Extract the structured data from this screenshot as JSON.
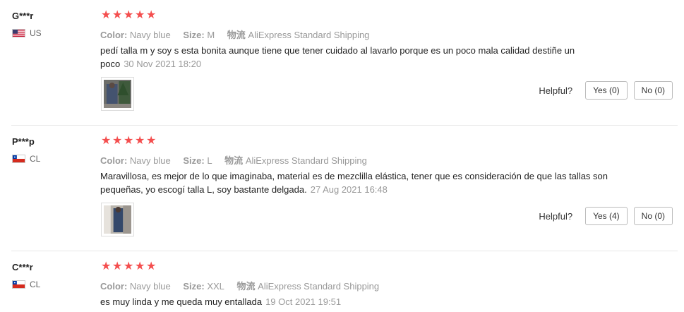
{
  "reviews": [
    {
      "user": "G***r",
      "country": "US",
      "flag": "us",
      "stars": 5,
      "color_label": "Color:",
      "color_value": "Navy blue",
      "size_label": "Size:",
      "size_value": "M",
      "shipping_label": "物流",
      "shipping_value": "AliExpress Standard Shipping",
      "text": "pedí talla m y soy s esta bonita aunque tiene que tener cuidado al lavarlo porque es un poco mala calidad destiñe un poco",
      "date": "30 Nov 2021 18:20",
      "has_photo": true,
      "helpful_label": "Helpful?",
      "yes_label": "Yes (0)",
      "no_label": "No (0)"
    },
    {
      "user": "P***p",
      "country": "CL",
      "flag": "cl",
      "stars": 5,
      "color_label": "Color:",
      "color_value": "Navy blue",
      "size_label": "Size:",
      "size_value": "L",
      "shipping_label": "物流",
      "shipping_value": "AliExpress Standard Shipping",
      "text": "Maravillosa, es mejor de lo que imaginaba, material es de mezclilla elástica, tener que es consideración de que las tallas son pequeñas, yo escogí talla L, soy bastante delgada.",
      "date": "27 Aug 2021 16:48",
      "has_photo": true,
      "helpful_label": "Helpful?",
      "yes_label": "Yes (4)",
      "no_label": "No (0)"
    },
    {
      "user": "C***r",
      "country": "CL",
      "flag": "cl",
      "stars": 5,
      "color_label": "Color:",
      "color_value": "Navy blue",
      "size_label": "Size:",
      "size_value": "XXL",
      "shipping_label": "物流",
      "shipping_value": "AliExpress Standard Shipping",
      "text": "es muy linda y me queda muy entallada",
      "date": "19 Oct 2021 19:51",
      "has_photo": false
    }
  ],
  "colors": {
    "star": "#f44e4e",
    "meta": "#999999",
    "separator": "#e8e8e8"
  },
  "icons": {
    "star": "star-icon",
    "flag_us": "us-flag-icon",
    "flag_cl": "chile-flag-icon"
  }
}
